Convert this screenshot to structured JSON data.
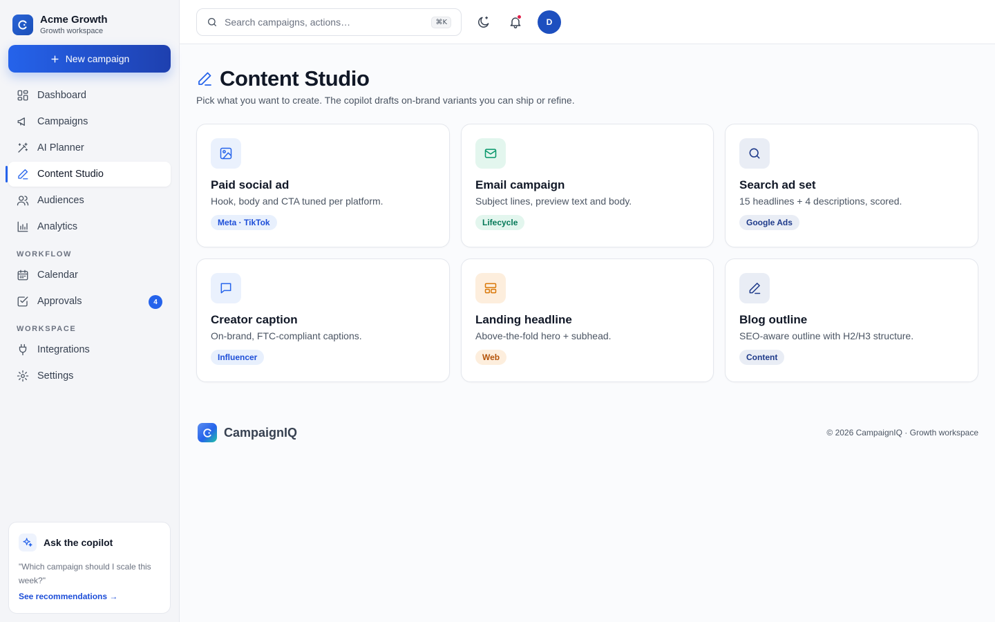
{
  "brand": {
    "name": "Acme Growth",
    "subtitle": "Growth workspace"
  },
  "sidebar": {
    "new_campaign_label": "New campaign",
    "nav": [
      {
        "label": "Dashboard",
        "icon": "dashboard-icon"
      },
      {
        "label": "Campaigns",
        "icon": "megaphone-icon"
      },
      {
        "label": "AI Planner",
        "icon": "magic-wand-icon"
      },
      {
        "label": "Content Studio",
        "icon": "pencil-icon",
        "active": true
      },
      {
        "label": "Audiences",
        "icon": "users-icon"
      },
      {
        "label": "Analytics",
        "icon": "bar-chart-icon"
      }
    ],
    "workflow_heading": "WORKFLOW",
    "workflow": [
      {
        "label": "Calendar",
        "icon": "calendar-icon"
      },
      {
        "label": "Approvals",
        "icon": "checkbox-icon",
        "badge": "4"
      }
    ],
    "workspace_heading": "WORKSPACE",
    "workspace": [
      {
        "label": "Integrations",
        "icon": "plug-icon"
      },
      {
        "label": "Settings",
        "icon": "gear-icon"
      }
    ],
    "copilot": {
      "title": "Ask the copilot",
      "quote": "\"Which campaign should I scale this week?\"",
      "link": "See recommendations →"
    }
  },
  "header": {
    "search_placeholder": "Search campaigns, actions…",
    "shortcut": "⌘K",
    "avatar_initial": "D"
  },
  "page": {
    "title": "Content Studio",
    "subtitle": "Pick what you want to create. The copilot drafts on-brand variants you can ship or refine."
  },
  "cards": [
    {
      "title": "Paid social ad",
      "desc": "Hook, body and CTA tuned per platform.",
      "tag": "Meta · TikTok",
      "icon": "image-icon",
      "accent": "#2563eb",
      "icon_bg": "#eaf1fd",
      "tag_bg": "#e8f0fd",
      "tag_color": "#1d4ed8"
    },
    {
      "title": "Email campaign",
      "desc": "Subject lines, preview text and body.",
      "tag": "Lifecycle",
      "icon": "mail-icon",
      "accent": "#059669",
      "icon_bg": "#e3f6ee",
      "tag_bg": "#e3f6ee",
      "tag_color": "#047857"
    },
    {
      "title": "Search ad set",
      "desc": "15 headlines + 4 descriptions, scored.",
      "tag": "Google Ads",
      "icon": "search-icon",
      "accent": "#1e3a8a",
      "icon_bg": "#e9edf5",
      "tag_bg": "#e9edf5",
      "tag_color": "#1e3a8a"
    },
    {
      "title": "Creator caption",
      "desc": "On-brand, FTC-compliant captions.",
      "tag": "Influencer",
      "icon": "chat-bubble-icon",
      "accent": "#2563eb",
      "icon_bg": "#eaf1fd",
      "tag_bg": "#e8f0fd",
      "tag_color": "#1d4ed8"
    },
    {
      "title": "Landing headline",
      "desc": "Above-the-fold hero + subhead.",
      "tag": "Web",
      "icon": "layout-icon",
      "accent": "#d97706",
      "icon_bg": "#fdeedd",
      "tag_bg": "#fdeedd",
      "tag_color": "#b45309"
    },
    {
      "title": "Blog outline",
      "desc": "SEO-aware outline with H2/H3 structure.",
      "tag": "Content",
      "icon": "pencil-icon",
      "accent": "#1e3a8a",
      "icon_bg": "#e9edf5",
      "tag_bg": "#e9edf5",
      "tag_color": "#1e3a8a"
    }
  ],
  "footer": {
    "logo_name": "CampaignIQ",
    "copyright": "© 2026 CampaignIQ · Growth workspace"
  }
}
